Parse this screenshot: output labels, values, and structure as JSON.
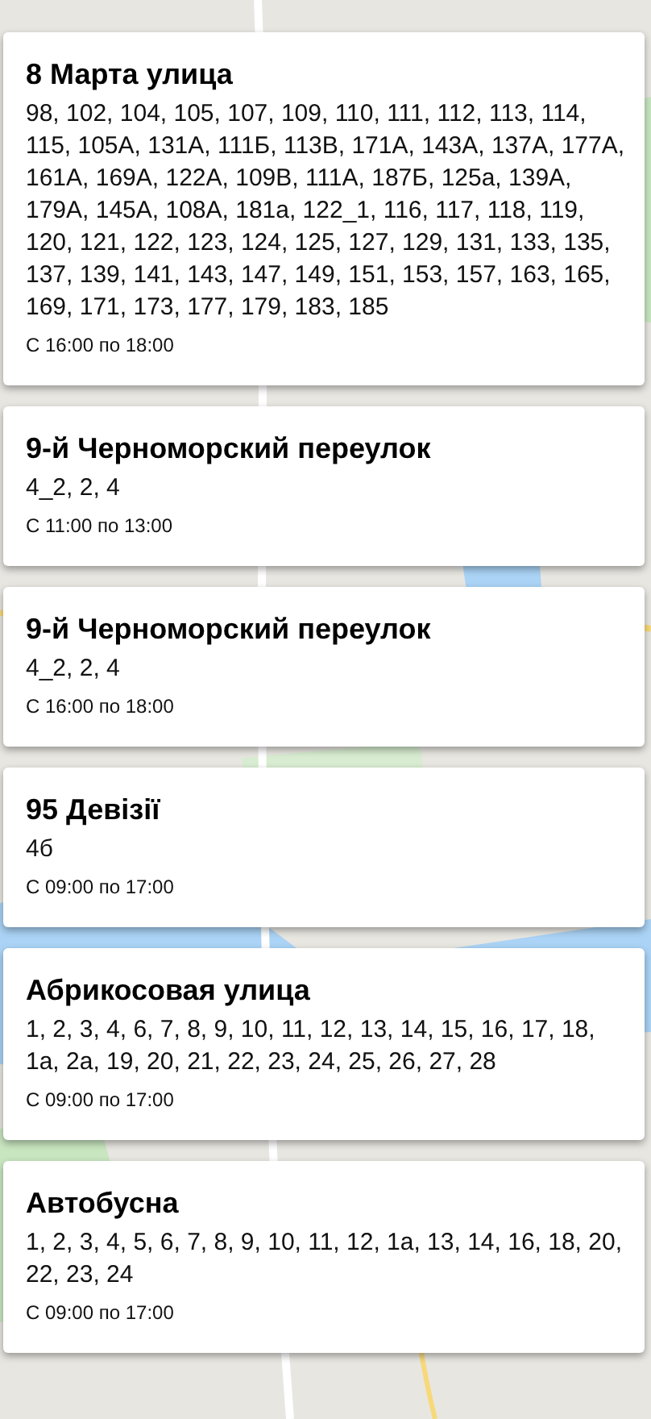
{
  "outages": [
    {
      "street": "8 Марта улица",
      "houses": "98, 102, 104, 105, 107, 109, 110, 111, 112, 113, 114, 115, 105А, 131А, 111Б, 113В, 171А, 143А, 137А, 177А, 161А, 169А, 122А, 109В, 111А, 187Б, 125а, 139А, 179А, 145А, 108А, 181а, 122_1, 116, 117, 118, 119, 120, 121, 122, 123, 124, 125, 127, 129, 131, 133, 135, 137, 139, 141, 143, 147, 149, 151, 153, 157, 163, 165, 169, 171, 173, 177, 179, 183, 185",
      "time": "С 16:00 по 18:00"
    },
    {
      "street": "9-й Черноморский переулок",
      "houses": "4_2, 2, 4",
      "time": "С 11:00 по 13:00"
    },
    {
      "street": "9-й Черноморский переулок",
      "houses": "4_2, 2, 4",
      "time": "С 16:00 по 18:00"
    },
    {
      "street": "95 Девізії",
      "houses": "4б",
      "time": "С 09:00 по 17:00"
    },
    {
      "street": "Абрикосовая улица",
      "houses": "1, 2, 3, 4, 6, 7, 8, 9, 10, 11, 12, 13, 14, 15, 16, 17, 18, 1а, 2а, 19, 20, 21, 22, 23, 24, 25, 26, 27, 28",
      "time": "С 09:00 по 17:00"
    },
    {
      "street": "Автобусна",
      "houses": "1, 2, 3, 4, 5, 6, 7, 8, 9, 10, 11, 12, 1а, 13, 14, 16, 18, 20, 22, 23, 24",
      "time": "С 09:00 по 17:00"
    }
  ]
}
